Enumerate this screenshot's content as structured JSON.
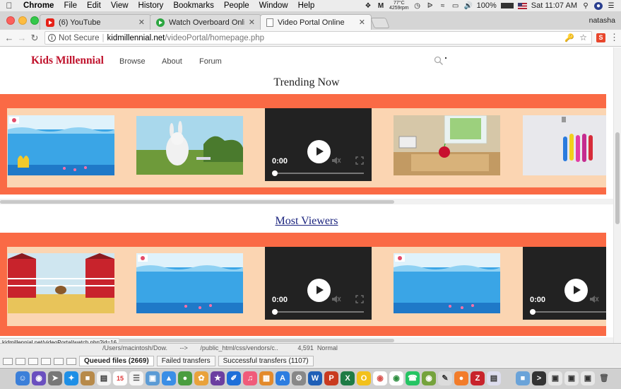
{
  "menubar": {
    "app_name": "Chrome",
    "items": [
      "File",
      "Edit",
      "View",
      "History",
      "Bookmarks",
      "People",
      "Window",
      "Help"
    ],
    "weather": "77°C",
    "rpm": "4259rpm",
    "battery": "100%",
    "datetime": "Sat 11:07 AM"
  },
  "tabs": [
    {
      "title": "(6) YouTube",
      "icon": "youtube-icon"
    },
    {
      "title": "Watch Overboard Online Free",
      "icon": "play-icon"
    },
    {
      "title": "Video Portal Online",
      "icon": "document-icon"
    }
  ],
  "profile_name": "natasha",
  "address_bar": {
    "security": "Not Secure",
    "host": "kidmillennial.net",
    "path": "/videoPortal/homepage.php"
  },
  "site": {
    "logo": "Kids Millennial",
    "nav": [
      "Browse",
      "About",
      "Forum"
    ]
  },
  "sections": {
    "trending_title": "Trending Now",
    "most_viewers_title": "Most Viewers"
  },
  "player": {
    "time": "0:00"
  },
  "status_url": "kidmillennial.net/videoPortal/watch.php?id=16",
  "background_app": {
    "log_line_left": "/Users/macintosh/Dow.",
    "log_arrow": "-->",
    "log_line_right": "/public_html/css/vendors/c..",
    "log_size": "4,591",
    "log_status": "Normal",
    "tabs": [
      "Queued files (2669)",
      "Failed transfers",
      "Successful transfers (1107)"
    ]
  },
  "dock": {
    "calendar_day": "15"
  },
  "colors": {
    "band": "#fa6a45",
    "band_inner": "#fbd5b2",
    "logo": "#c0122c",
    "player": "#222222"
  }
}
